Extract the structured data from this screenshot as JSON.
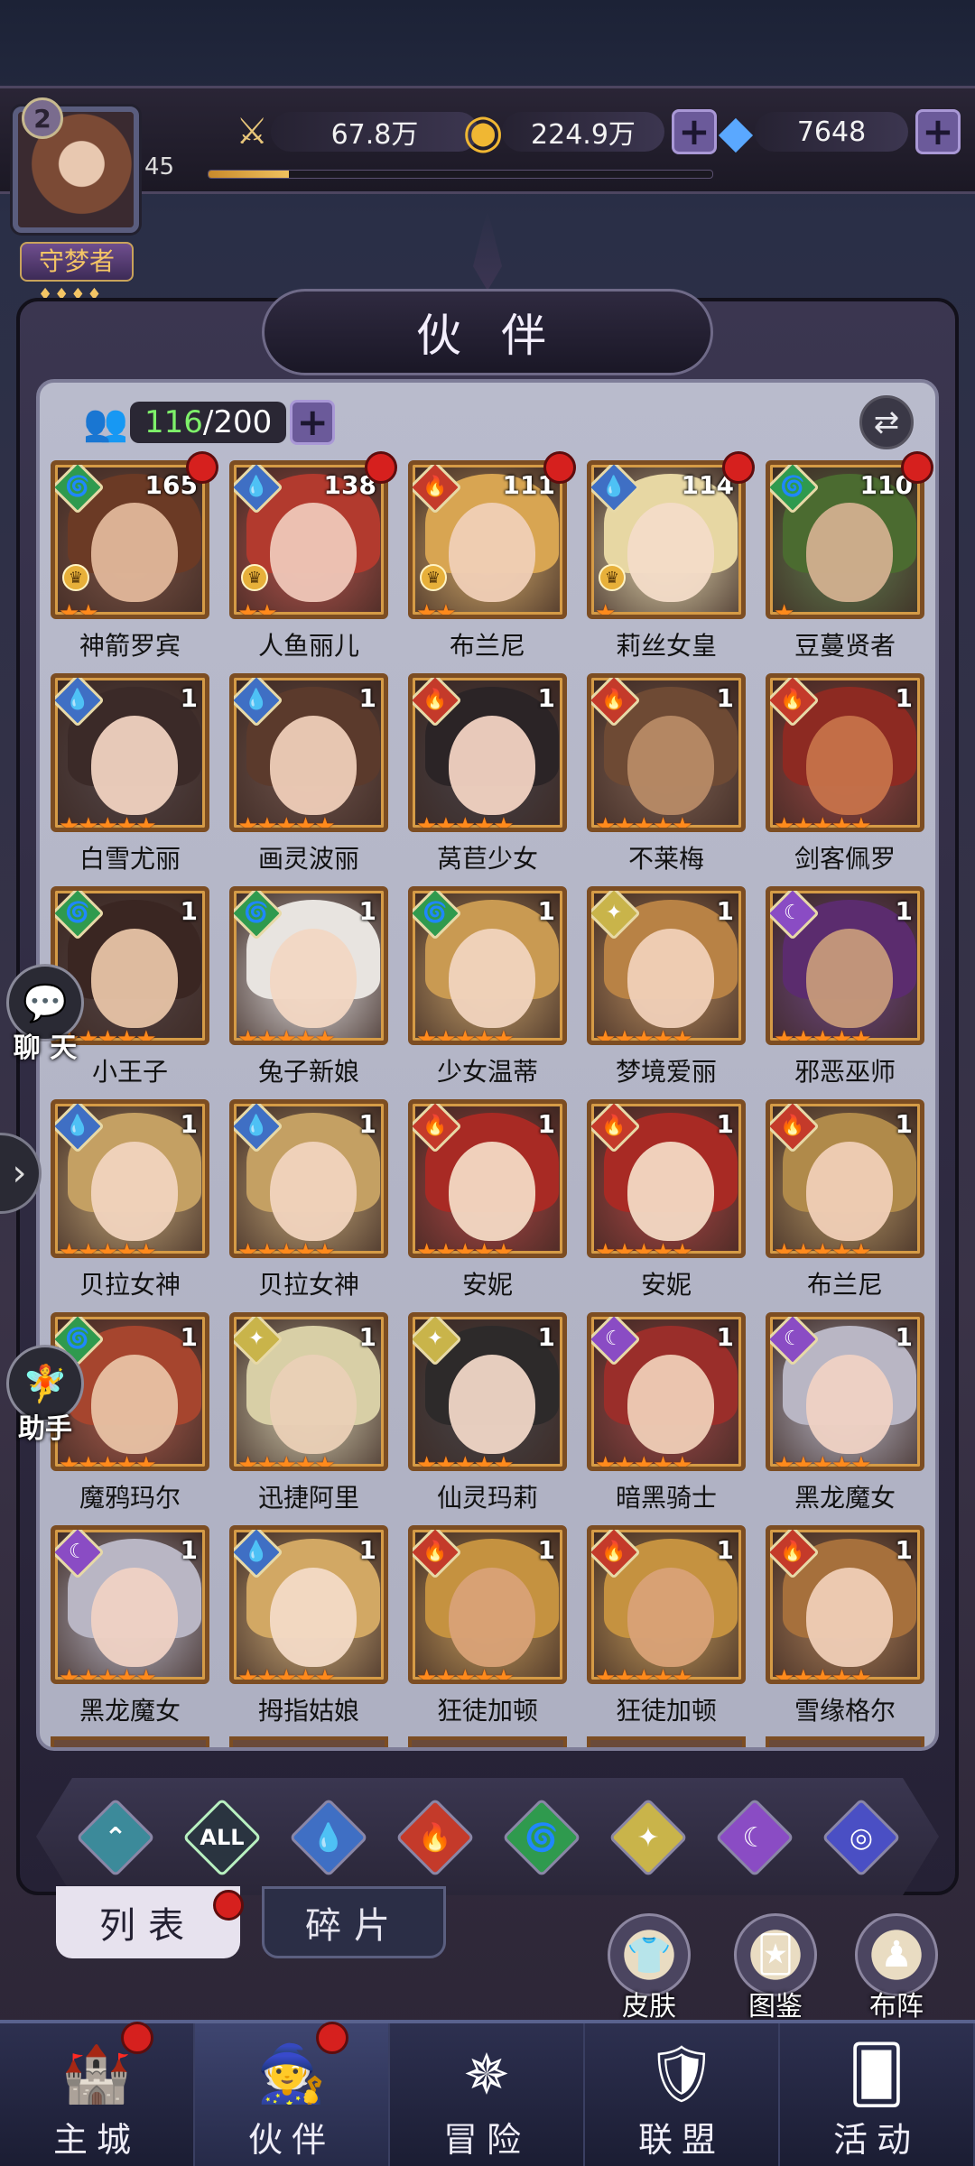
{
  "player": {
    "level_badge": "2",
    "level": "45",
    "xp_progress": 0.16,
    "title": "守梦者",
    "title_stars": "♦♦♦♦"
  },
  "resources": [
    {
      "icon": "sword-power-icon",
      "glyph": "⚔",
      "value": "67.8万",
      "has_plus": false
    },
    {
      "icon": "gold-coin-icon",
      "glyph": "◉",
      "value": "224.9万",
      "has_plus": true
    },
    {
      "icon": "diamond-icon",
      "glyph": "◆",
      "value": "7648",
      "has_plus": true
    }
  ],
  "panel": {
    "title": "伙 伴",
    "count_current": "116",
    "count_max": "/200",
    "plus": "✚"
  },
  "elements": {
    "water": {
      "glyph": "💧",
      "bg": "#3f6fc4"
    },
    "fire": {
      "glyph": "🔥",
      "bg": "#c43a2a"
    },
    "wind": {
      "glyph": "🌀",
      "bg": "#2f9a4e"
    },
    "light": {
      "glyph": "✦",
      "bg": "#c9b44a"
    },
    "dark": {
      "glyph": "☾",
      "bg": "#8a4cc4"
    }
  },
  "partners": [
    {
      "name": "神箭罗宾",
      "level": "165",
      "element": "wind",
      "stars": "★★",
      "red_dot": true,
      "crown": true,
      "hair": "#6b3a25",
      "skin": "#e2b79a"
    },
    {
      "name": "人鱼丽儿",
      "level": "138",
      "element": "water",
      "stars": "★★",
      "red_dot": true,
      "crown": true,
      "hair": "#b23a2e",
      "skin": "#efc7b8"
    },
    {
      "name": "布兰尼",
      "level": "111",
      "element": "fire",
      "stars": "★★",
      "red_dot": true,
      "crown": true,
      "hair": "#d8a552",
      "skin": "#f0cfb6"
    },
    {
      "name": "莉丝女皇",
      "level": "114",
      "element": "water",
      "stars": "★",
      "red_dot": true,
      "crown": true,
      "hair": "#e7d7a3",
      "skin": "#f3dcc8"
    },
    {
      "name": "豆蔓贤者",
      "level": "110",
      "element": "wind",
      "stars": "★",
      "red_dot": true,
      "crown": false,
      "hair": "#4b6b30",
      "skin": "#d2b08f"
    },
    {
      "name": "白雪尤丽",
      "level": "1",
      "element": "water",
      "stars": "★★★★★",
      "red_dot": false,
      "crown": false,
      "hair": "#3b2a28",
      "skin": "#f0d2c0"
    },
    {
      "name": "画灵波丽",
      "level": "1",
      "element": "water",
      "stars": "★★★★★",
      "red_dot": false,
      "crown": false,
      "hair": "#5b3a2c",
      "skin": "#efcdb8"
    },
    {
      "name": "莴苣少女",
      "level": "1",
      "element": "fire",
      "stars": "★★★★★",
      "red_dot": false,
      "crown": false,
      "hair": "#2b2426",
      "skin": "#f2d3c2"
    },
    {
      "name": "不莱梅",
      "level": "1",
      "element": "fire",
      "stars": "★★★★★",
      "red_dot": false,
      "crown": false,
      "hair": "#6e4a34",
      "skin": "#b78a66"
    },
    {
      "name": "剑客佩罗",
      "level": "1",
      "element": "fire",
      "stars": "★★★★★",
      "red_dot": false,
      "crown": false,
      "hair": "#8d2a22",
      "skin": "#c6724a"
    },
    {
      "name": "小王子",
      "level": "1",
      "element": "wind",
      "stars": "★★★★★",
      "red_dot": false,
      "crown": false,
      "hair": "#3a2622",
      "skin": "#e7c3a6"
    },
    {
      "name": "兔子新娘",
      "level": "1",
      "element": "wind",
      "stars": "★★★★★",
      "red_dot": false,
      "crown": false,
      "hair": "#e8e4e0",
      "skin": "#f2d7c3"
    },
    {
      "name": "少女温蒂",
      "level": "1",
      "element": "wind",
      "stars": "★★★★★",
      "red_dot": false,
      "crown": false,
      "hair": "#c99a52",
      "skin": "#f1d4be"
    },
    {
      "name": "梦境爱丽",
      "level": "1",
      "element": "light",
      "stars": "★★★★★",
      "red_dot": false,
      "crown": false,
      "hair": "#b88245",
      "skin": "#f0d0b8"
    },
    {
      "name": "邪恶巫师",
      "level": "1",
      "element": "dark",
      "stars": "★★★★★",
      "red_dot": false,
      "crown": false,
      "hair": "#5b2c6e",
      "skin": "#c79a7a"
    },
    {
      "name": "贝拉女神",
      "level": "1",
      "element": "water",
      "stars": "★★★★★",
      "red_dot": false,
      "crown": false,
      "hair": "#c4a063",
      "skin": "#f1d4be"
    },
    {
      "name": "贝拉女神",
      "level": "1",
      "element": "water",
      "stars": "★★★★★",
      "red_dot": false,
      "crown": false,
      "hair": "#c4a063",
      "skin": "#f1d4be"
    },
    {
      "name": "安妮",
      "level": "1",
      "element": "fire",
      "stars": "★★★★★",
      "red_dot": false,
      "crown": false,
      "hair": "#a82a24",
      "skin": "#f3d9c4"
    },
    {
      "name": "安妮",
      "level": "1",
      "element": "fire",
      "stars": "★★★★★",
      "red_dot": false,
      "crown": false,
      "hair": "#a82a24",
      "skin": "#f3d9c4"
    },
    {
      "name": "布兰尼",
      "level": "1",
      "element": "fire",
      "stars": "★★★★★",
      "red_dot": false,
      "crown": false,
      "hair": "#b08a4a",
      "skin": "#f0cfb6"
    },
    {
      "name": "魔鸦玛尔",
      "level": "1",
      "element": "wind",
      "stars": "★★★★★",
      "red_dot": false,
      "crown": false,
      "hair": "#a6452e",
      "skin": "#e8c2a4"
    },
    {
      "name": "迅捷阿里",
      "level": "1",
      "element": "light",
      "stars": "★★★★★",
      "red_dot": false,
      "crown": false,
      "hair": "#d8cfa6",
      "skin": "#ead0b6"
    },
    {
      "name": "仙灵玛莉",
      "level": "1",
      "element": "light",
      "stars": "★★★★★",
      "red_dot": false,
      "crown": false,
      "hair": "#2d2a2a",
      "skin": "#f0d6c6"
    },
    {
      "name": "暗黑骑士",
      "level": "1",
      "element": "dark",
      "stars": "★★★★★",
      "red_dot": false,
      "crown": false,
      "hair": "#9a2e2a",
      "skin": "#efcdb6"
    },
    {
      "name": "黑龙魔女",
      "level": "1",
      "element": "dark",
      "stars": "★★★★★",
      "red_dot": false,
      "crown": false,
      "hair": "#b9b6c4",
      "skin": "#efd2c4"
    },
    {
      "name": "黑龙魔女",
      "level": "1",
      "element": "dark",
      "stars": "★★★★★",
      "red_dot": false,
      "crown": false,
      "hair": "#b9b6c4",
      "skin": "#efd2c4"
    },
    {
      "name": "拇指姑娘",
      "level": "1",
      "element": "water",
      "stars": "★★★★★",
      "red_dot": false,
      "crown": false,
      "hair": "#d2a864",
      "skin": "#f3dac6"
    },
    {
      "name": "狂徒加顿",
      "level": "1",
      "element": "fire",
      "stars": "★★★★★",
      "red_dot": false,
      "crown": false,
      "hair": "#c59240",
      "skin": "#d9a277"
    },
    {
      "name": "狂徒加顿",
      "level": "1",
      "element": "fire",
      "stars": "★★★★★",
      "red_dot": false,
      "crown": false,
      "hair": "#c59240",
      "skin": "#d9a277"
    },
    {
      "name": "雪缘格尔",
      "level": "1",
      "element": "fire",
      "stars": "★★★★★",
      "red_dot": false,
      "crown": false,
      "hair": "#a6703c",
      "skin": "#efcdb6"
    }
  ],
  "filters": [
    {
      "name": "filter-all-types",
      "glyph": "⌃",
      "color": "#3c8a9a",
      "active": false
    },
    {
      "name": "filter-all",
      "glyph": "ALL",
      "color": "#2a3440",
      "active": true
    },
    {
      "name": "filter-water",
      "glyph": "💧",
      "color": "#3f6fc4",
      "active": false
    },
    {
      "name": "filter-fire",
      "glyph": "🔥",
      "color": "#c43a2a",
      "active": false
    },
    {
      "name": "filter-wind",
      "glyph": "🌀",
      "color": "#2f9a4e",
      "active": false
    },
    {
      "name": "filter-light",
      "glyph": "✦",
      "color": "#c9b44a",
      "active": false
    },
    {
      "name": "filter-dark",
      "glyph": "☾",
      "color": "#8a4cc4",
      "active": false
    },
    {
      "name": "filter-void",
      "glyph": "◎",
      "color": "#4a4fc4",
      "active": false
    }
  ],
  "tabs": {
    "list": "列表",
    "fragments": "碎片"
  },
  "shortcuts": [
    {
      "name": "skins-button",
      "label": "皮肤",
      "glyph": "👕"
    },
    {
      "name": "codex-button",
      "label": "图鉴",
      "glyph": "🃏"
    },
    {
      "name": "formation-button",
      "label": "布阵",
      "glyph": "♟"
    }
  ],
  "side": {
    "chat": "聊 天",
    "assistant": "助手"
  },
  "nav": [
    {
      "name": "nav-main-city",
      "label": "主城",
      "glyph": "🏰",
      "active": false,
      "red_dot": true
    },
    {
      "name": "nav-partners",
      "label": "伙伴",
      "glyph": "🧙",
      "active": true,
      "red_dot": true
    },
    {
      "name": "nav-adventure",
      "label": "冒险",
      "glyph": "✵",
      "active": false,
      "red_dot": false
    },
    {
      "name": "nav-alliance",
      "label": "联盟",
      "glyph": "🛡",
      "active": false,
      "red_dot": false
    },
    {
      "name": "nav-events",
      "label": "活动",
      "glyph": "🂠",
      "active": false,
      "red_dot": false
    }
  ],
  "colors": {
    "accent_green": "#7ef06a",
    "red_dot": "#d6201e",
    "star_orange": "#ff8a1c"
  }
}
